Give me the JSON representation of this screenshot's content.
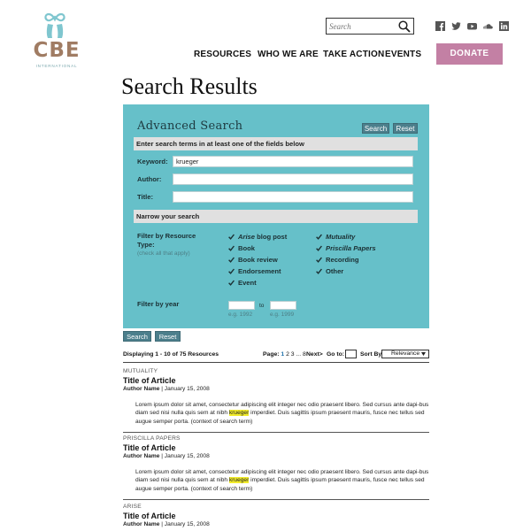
{
  "brand": {
    "logo_text": "CBE",
    "logo_subtext": "INTERNATIONAL",
    "color_logo": "#a07c63",
    "color_mark": "#7fc6cf"
  },
  "header": {
    "search_placeholder": "Search",
    "social_icons": [
      "facebook-icon",
      "twitter-icon",
      "youtube-icon",
      "soundcloud-icon",
      "linkedin-icon"
    ],
    "nav": [
      "RESOURCES",
      "WHO WE ARE",
      "TAKE ACTION",
      "EVENTS"
    ],
    "donate_label": "DONATE",
    "donate_color": "#c380a4"
  },
  "page_title": "Search Results",
  "advanced": {
    "title": "Advanced Search",
    "search_btn": "Search",
    "reset_btn": "Reset",
    "band1": "Enter search terms in at least one of the fields below",
    "keyword_label": "Keyword:",
    "keyword_value": "krueger",
    "author_label": "Author:",
    "title_label": "Title:",
    "band2": "Narrow your search",
    "filter_type_label_1": "Filter by Resource",
    "filter_type_label_2": "Type:",
    "filter_type_hint": "(check all that apply)",
    "types_col1": [
      {
        "lead": "Arise",
        "rest": " blog post",
        "italic_lead": true
      },
      {
        "lead": "Book",
        "rest": "",
        "italic_lead": false
      },
      {
        "lead": "Book review",
        "rest": "",
        "italic_lead": false
      },
      {
        "lead": "Endorsement",
        "rest": "",
        "italic_lead": false
      },
      {
        "lead": "Event",
        "rest": "",
        "italic_lead": false
      }
    ],
    "types_col2": [
      {
        "lead": "Mutuality",
        "rest": "",
        "italic_lead": true
      },
      {
        "lead": "Priscilla Papers",
        "rest": "",
        "italic_lead": true
      },
      {
        "lead": "Recording",
        "rest": "",
        "italic_lead": false
      },
      {
        "lead": "Other",
        "rest": "",
        "italic_lead": false
      }
    ],
    "year_label": "Filter by year",
    "year_to": "to",
    "year_from_hint": "e.g. 1992",
    "year_to_hint": "e.g. 1999",
    "panel_color": "#66c0c9"
  },
  "bottom_buttons": {
    "search": "Search",
    "reset": "Reset"
  },
  "results_bar": {
    "displaying": "Displaying 1 - 10 of 75 Resources",
    "page_label": "Page:",
    "page_1": "1",
    "page_rest": " 2 3 ... 8",
    "next": "Next>",
    "goto": "Go to:",
    "sort_by": "Sort By:",
    "sort_value": "Relevance"
  },
  "results": [
    {
      "category": "MUTUALITY",
      "title": "Title of Article",
      "author": "Author Name",
      "date": " | January 15, 2008",
      "snip_a": "Lorem ipsum dolor sit amet, consectetur adipiscing elit integer nec odio praesent libero. Sed cursus ante dapi-bus diam sed nisi nulla quis sem at nibh ",
      "snip_hl": "krueger",
      "snip_b": " imperdiet. Duis sagittis ipsum praesent mauris, fusce nec tellus sed augue semper porta.   (context of search term)"
    },
    {
      "category": "PRISCILLA PAPERS",
      "title": "Title of Article",
      "author": "Author Name",
      "date": " | January 15, 2008",
      "snip_a": "Lorem ipsum dolor sit amet, consectetur adipiscing elit integer nec odio praesent libero. Sed cursus ante dapi-bus diam sed nisi nulla quis sem at nibh ",
      "snip_hl": "krueger",
      "snip_b": " imperdiet. Duis sagittis ipsum praesent mauris, fusce nec tellus sed augue semper porta.   (context of search term)"
    },
    {
      "category": "ARISE",
      "title": "Title of Article",
      "author": "Author Name",
      "date": " | January 15, 2008"
    }
  ]
}
